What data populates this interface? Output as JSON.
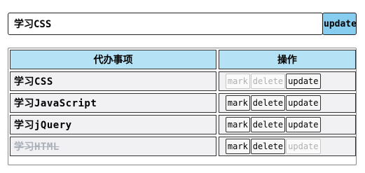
{
  "input": {
    "value": "学习CSS",
    "update_label": "update"
  },
  "table": {
    "headers": {
      "item": "代办事项",
      "ops": "操作"
    },
    "rows": [
      {
        "label": "学习CSS",
        "done": false,
        "mark": "mark",
        "delete": "delete",
        "update": "update",
        "mark_enabled": false,
        "delete_enabled": false,
        "update_enabled": true
      },
      {
        "label": "学习JavaScript",
        "done": false,
        "mark": "mark",
        "delete": "delete",
        "update": "update",
        "mark_enabled": true,
        "delete_enabled": true,
        "update_enabled": true
      },
      {
        "label": "学习jQuery",
        "done": false,
        "mark": "mark",
        "delete": "delete",
        "update": "update",
        "mark_enabled": true,
        "delete_enabled": true,
        "update_enabled": true
      },
      {
        "label": "学习HTML",
        "done": true,
        "mark": "mark",
        "delete": "delete",
        "update": "update",
        "mark_enabled": true,
        "delete_enabled": true,
        "update_enabled": false
      }
    ]
  },
  "colors": {
    "accent": "#87cdf0",
    "header_bg": "#b5e3f5",
    "row_bg": "#f1f1f3",
    "done_text": "#aab0b8"
  }
}
